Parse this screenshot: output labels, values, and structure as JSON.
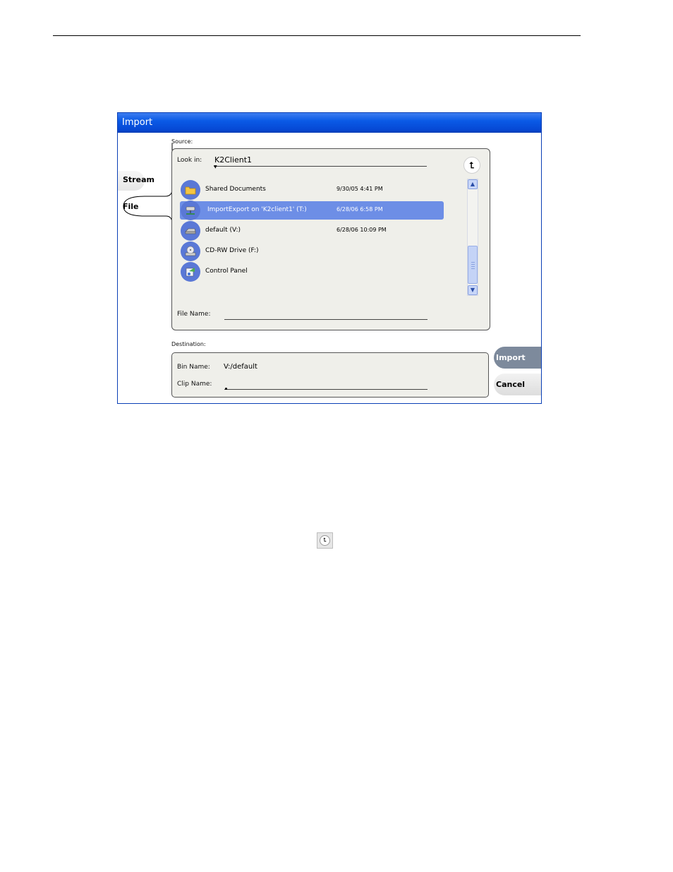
{
  "dialog": {
    "title": "Import",
    "tabs": [
      {
        "label": "Stream",
        "selected": false
      },
      {
        "label": "File",
        "selected": true
      }
    ],
    "source": {
      "section_label": "Source:",
      "look_in_label": "Look in:",
      "look_in_value": "K2Client1",
      "up_icon": "up-folder-icon",
      "items": [
        {
          "name": "Shared Documents",
          "date": "9/30/05 4:41 PM",
          "icon": "folder-icon",
          "selected": false
        },
        {
          "name": "ImportExport on 'K2client1' (T:)",
          "date": "6/28/06 6:58 PM",
          "icon": "network-drive-icon",
          "selected": true
        },
        {
          "name": "default (V:)",
          "date": "6/28/06 10:09 PM",
          "icon": "hard-drive-icon",
          "selected": false
        },
        {
          "name": "CD-RW Drive (F:)",
          "date": "",
          "icon": "cd-drive-icon",
          "selected": false
        },
        {
          "name": "Control Panel",
          "date": "",
          "icon": "control-panel-icon",
          "selected": false
        }
      ],
      "file_name_label": "File Name:",
      "file_name_value": ""
    },
    "destination": {
      "section_label": "Destination:",
      "bin_name_label": "Bin Name:",
      "bin_name_value": "V:/default",
      "clip_name_label": "Clip Name:",
      "clip_name_value": ""
    },
    "buttons": {
      "import": "Import",
      "cancel": "Cancel"
    }
  },
  "inline_icon": "up-folder-icon",
  "colors": {
    "titlebar": "#0a5ae6",
    "selection": "#6d8ee6",
    "icon_circle": "#5a78d6",
    "import_button": "#7d8a9c"
  }
}
